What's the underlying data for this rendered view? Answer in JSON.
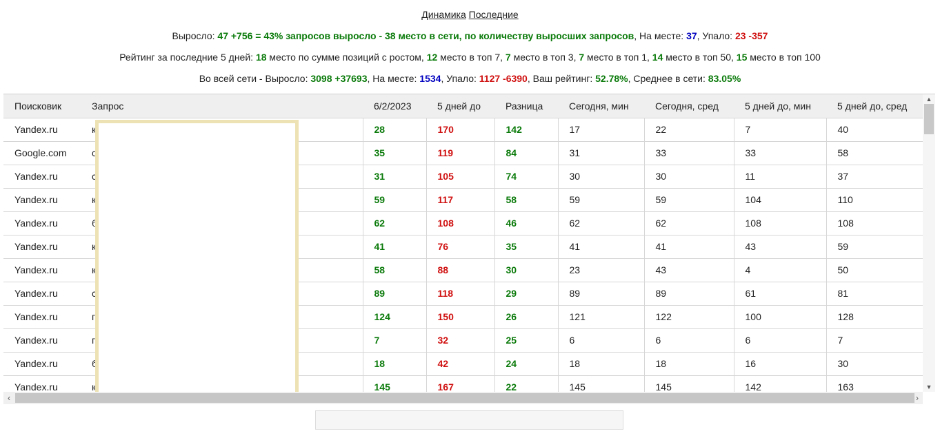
{
  "links": {
    "dynamics": "Динамика",
    "latest": "Последние"
  },
  "summary": {
    "grew_label": "Выросло: ",
    "grew_value": "47 +756 = 43% запросов выросло - 38 место в сети, по количеству выросших запросов",
    "stay_label": ", На месте: ",
    "stay_value": "37",
    "fell_label": ", Упало: ",
    "fell_value": "23 -357"
  },
  "rating": {
    "label": "Рейтинг за последние 5 дней: ",
    "v1": "18",
    "t1": " место по сумме позиций с ростом, ",
    "v2": "12",
    "t2": " место в топ 7, ",
    "v3": "7",
    "t3": " место в топ 3, ",
    "v4": "7",
    "t4": " место в топ 1, ",
    "v5": "14",
    "t5": " место в топ 50, ",
    "v6": "15",
    "t6": " место в топ 100"
  },
  "network": {
    "label": "Во всей сети - Выросло: ",
    "grew": "3098 +37693",
    "stay_label": ", На месте: ",
    "stay": "1534",
    "fell_label": ", Упало: ",
    "fell": "1127 -6390",
    "rating_label": ", Ваш рейтинг: ",
    "rating": "52.78%",
    "avg_label": ", Среднее в сети: ",
    "avg": "83.05%"
  },
  "table": {
    "headers": [
      "Поисковик",
      "Запрос",
      "6/2/2023",
      "5 дней до",
      "Разница",
      "Сегодня, мин",
      "Сегодня, сред",
      "5 дней до, мин",
      "5 дней до, сред"
    ],
    "rows": [
      [
        "Yandex.ru",
        "к",
        "28",
        "170",
        "142",
        "17",
        "22",
        "7",
        "40"
      ],
      [
        "Google.com",
        "с",
        "35",
        "119",
        "84",
        "31",
        "33",
        "33",
        "58"
      ],
      [
        "Yandex.ru",
        "с",
        "31",
        "105",
        "74",
        "30",
        "30",
        "11",
        "37"
      ],
      [
        "Yandex.ru",
        "к",
        "59",
        "117",
        "58",
        "59",
        "59",
        "104",
        "110"
      ],
      [
        "Yandex.ru",
        "б",
        "62",
        "108",
        "46",
        "62",
        "62",
        "108",
        "108"
      ],
      [
        "Yandex.ru",
        "к",
        "41",
        "76",
        "35",
        "41",
        "41",
        "43",
        "59"
      ],
      [
        "Yandex.ru",
        "к",
        "58",
        "88",
        "30",
        "23",
        "43",
        "4",
        "50"
      ],
      [
        "Yandex.ru",
        "с",
        "89",
        "118",
        "29",
        "89",
        "89",
        "61",
        "81"
      ],
      [
        "Yandex.ru",
        "г",
        "124",
        "150",
        "26",
        "121",
        "122",
        "100",
        "128"
      ],
      [
        "Yandex.ru",
        "г",
        "7",
        "32",
        "25",
        "6",
        "6",
        "6",
        "7"
      ],
      [
        "Yandex.ru",
        "б",
        "18",
        "42",
        "24",
        "18",
        "18",
        "16",
        "30"
      ],
      [
        "Yandex.ru",
        "к",
        "145",
        "167",
        "22",
        "145",
        "145",
        "142",
        "163"
      ]
    ]
  },
  "colors": {
    "positive": "#0a7a0a",
    "negative": "#d01010",
    "neutral_blue": "#0000c0"
  }
}
